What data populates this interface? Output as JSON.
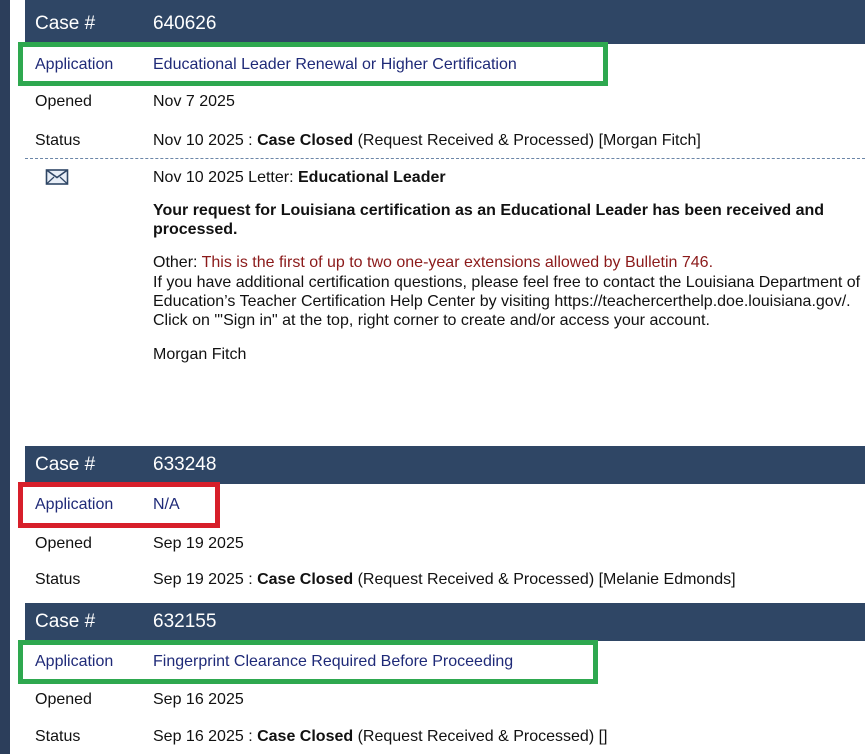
{
  "cases": [
    {
      "header_label": "Case #",
      "case_number": "640626",
      "application_label": "Application",
      "application_value": "Educational Leader Renewal or Higher Certification",
      "opened_label": "Opened",
      "opened_value": "Nov 7 2025",
      "status_label": "Status",
      "status_date": "Nov 10 2025 :",
      "status_bold": "Case Closed",
      "status_detail": "(Request Received & Processed) [Morgan Fitch]",
      "highlight": "green"
    },
    {
      "header_label": "Case #",
      "case_number": "633248",
      "application_label": "Application",
      "application_value": "N/A",
      "opened_label": "Opened",
      "opened_value": "Sep 19 2025",
      "status_label": "Status",
      "status_date": "Sep 19 2025 :",
      "status_bold": "Case Closed",
      "status_detail": "(Request Received & Processed) [Melanie Edmonds]",
      "highlight": "red"
    },
    {
      "header_label": "Case #",
      "case_number": "632155",
      "application_label": "Application",
      "application_value": "Fingerprint Clearance Required Before Proceeding",
      "opened_label": "Opened",
      "opened_value": "Sep 16 2025",
      "status_label": "Status",
      "status_date": "Sep 16 2025 :",
      "status_bold": "Case Closed",
      "status_detail": "(Request Received & Processed) []",
      "highlight": "green"
    }
  ],
  "letter": {
    "icon": "envelope-icon",
    "date": "Nov 10 2025 Letter:",
    "subject": "Educational Leader",
    "main_text": "Your request for Louisiana certification as an Educational Leader has been received and processed.",
    "other_label": "Other:",
    "other_text": "This is the first of up to two one-year extensions allowed by Bulletin 746.",
    "body_text": "If you have additional certification questions, please feel free to contact the Louisiana Department of Education’s Teacher Certification Help Center by visiting https://teachercerthelp.doe.louisiana.gov/. Click on \"'Sign in\" at the top, right corner to create and/or access your account.",
    "signature": "Morgan Fitch"
  },
  "colors": {
    "header_bg": "#2f4665",
    "application_text": "#1f2a78",
    "highlight_green": "#2ea84f",
    "highlight_red": "#d71f2a",
    "other_text": "#8b1a1a"
  }
}
